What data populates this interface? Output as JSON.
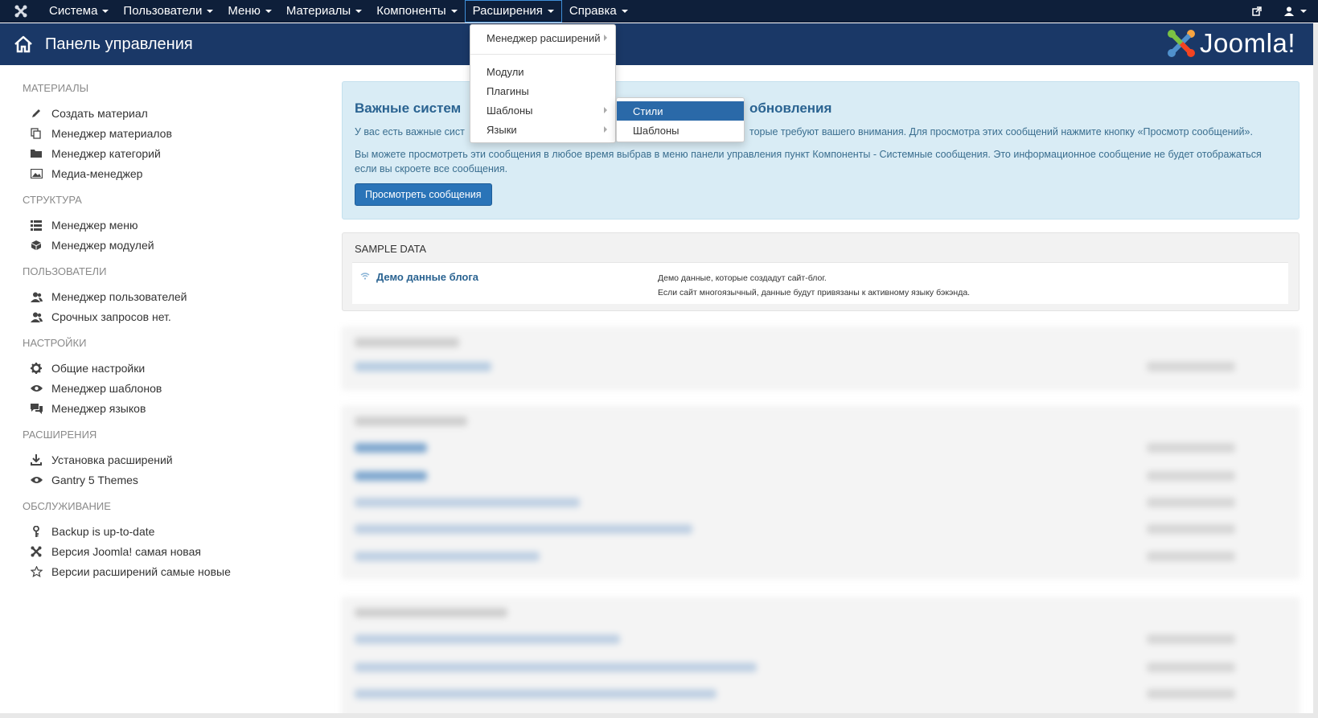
{
  "navbar": {
    "menus": [
      {
        "label": "Система"
      },
      {
        "label": "Пользователи"
      },
      {
        "label": "Меню"
      },
      {
        "label": "Материалы"
      },
      {
        "label": "Компоненты"
      },
      {
        "label": "Расширения"
      },
      {
        "label": "Справка"
      }
    ]
  },
  "header": {
    "title": "Панель управления",
    "brand": "Joomla!"
  },
  "sidebar": {
    "sections": [
      {
        "heading": "МАТЕРИАЛЫ",
        "items": [
          {
            "label": "Создать материал",
            "icon": "pencil-icon"
          },
          {
            "label": "Менеджер материалов",
            "icon": "copy-icon"
          },
          {
            "label": "Менеджер категорий",
            "icon": "folder-icon"
          },
          {
            "label": "Медиа-менеджер",
            "icon": "image-icon"
          }
        ]
      },
      {
        "heading": "СТРУКТУРА",
        "items": [
          {
            "label": "Менеджер меню",
            "icon": "list-icon"
          },
          {
            "label": "Менеджер модулей",
            "icon": "cube-icon"
          }
        ]
      },
      {
        "heading": "ПОЛЬЗОВАТЕЛИ",
        "items": [
          {
            "label": "Менеджер пользователей",
            "icon": "users-icon"
          },
          {
            "label": "Срочных запросов нет.",
            "icon": "users-icon"
          }
        ]
      },
      {
        "heading": "НАСТРОЙКИ",
        "items": [
          {
            "label": "Общие настройки",
            "icon": "gear-icon"
          },
          {
            "label": "Менеджер шаблонов",
            "icon": "eye-icon"
          },
          {
            "label": "Менеджер языков",
            "icon": "comments-icon"
          }
        ]
      },
      {
        "heading": "РАСШИРЕНИЯ",
        "items": [
          {
            "label": "Установка расширений",
            "icon": "download-icon"
          },
          {
            "label": "Gantry 5 Themes",
            "icon": "eye-icon"
          }
        ]
      },
      {
        "heading": "ОБСЛУЖИВАНИЕ",
        "items": [
          {
            "label": "Backup is up-to-date",
            "icon": "key-icon"
          },
          {
            "label": "Версия Joomla! самая новая",
            "icon": "joomla-icon"
          },
          {
            "label": "Версии расширений самые новые",
            "icon": "star-icon"
          }
        ]
      }
    ]
  },
  "alert": {
    "title_left": "Важные систем",
    "title_right": "обновления",
    "text1_left": "У вас есть важные сист",
    "text1_right": "торые требуют вашего внимания. Для просмотра этих сообщений нажмите кнопку «Просмотр сообщений».",
    "text2": "Вы можете просмотреть эти сообщения в любое время выбрав в меню панели управления пункт Компоненты - Системные сообщения. Это информационное сообщение не будет отображаться если вы скроете все сообщения.",
    "button": "Просмотреть сообщения"
  },
  "sample_data": {
    "title": "SAMPLE DATA",
    "link": "Демо данные блога",
    "desc_line1": "Демо данные, которые создадут сайт-блог.",
    "desc_line2": "Если сайт многоязычный, данные будут привязаны к активному языку бэкэнда."
  },
  "dropdown": {
    "items": [
      {
        "label": "Менеджер расширений",
        "has_sub": true
      },
      {
        "label": "Модули",
        "has_sub": false
      },
      {
        "label": "Плагины",
        "has_sub": false
      },
      {
        "label": "Шаблоны",
        "has_sub": true
      },
      {
        "label": "Языки",
        "has_sub": true
      }
    ],
    "submenu": [
      {
        "label": "Стили"
      },
      {
        "label": "Шаблоны"
      }
    ]
  },
  "colors": {
    "navbar": "#0e1f3a",
    "header": "#1a3867",
    "accent": "#2a69a8",
    "alert_bg": "#d9ecf5"
  }
}
